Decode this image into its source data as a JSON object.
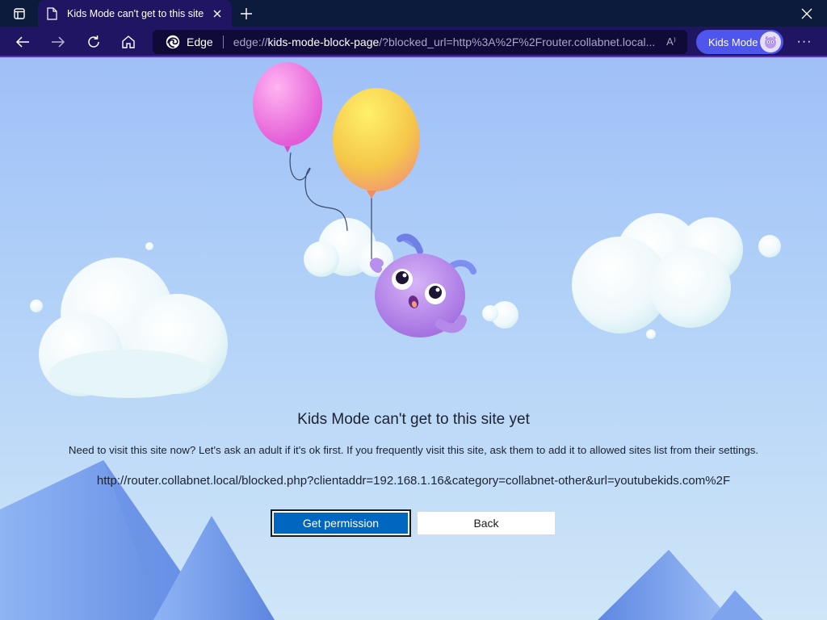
{
  "browser": {
    "tab": {
      "title": "Kids Mode can't get to this site y",
      "favicon": "page-icon"
    },
    "address": {
      "brand": "Edge",
      "url_prefix": "edge://",
      "url_host": "kids-mode-block-page",
      "url_rest": "/?blocked_url=http%3A%2F%2Frouter.collabnet.local..."
    },
    "kids_mode_label": "Kids Mode",
    "read_aloud_glyph": "A⁾",
    "more_glyph": "···",
    "colors": {
      "titlebar": "#0c1a3b",
      "toolbar": "#1f1563",
      "accent": "#5b2ed1",
      "kids_pill": "#4f56ee"
    }
  },
  "page": {
    "heading": "Kids Mode can't get to this site yet",
    "message": "Need to visit this site now? Let's ask an adult if it's ok first. If you frequently visit this site, ask them to add it to allowed sites list from their settings.",
    "blocked_url": "http://router.collabnet.local/blocked.php?clientaddr=192.168.1.16&category=collabnet-other&url=youtubekids.com%2F",
    "primary_button": "Get permission",
    "secondary_button": "Back",
    "colors": {
      "primary_button": "#0067c0",
      "sky_top": "#9fc0f7",
      "sky_bottom": "#cfe6f7"
    }
  }
}
